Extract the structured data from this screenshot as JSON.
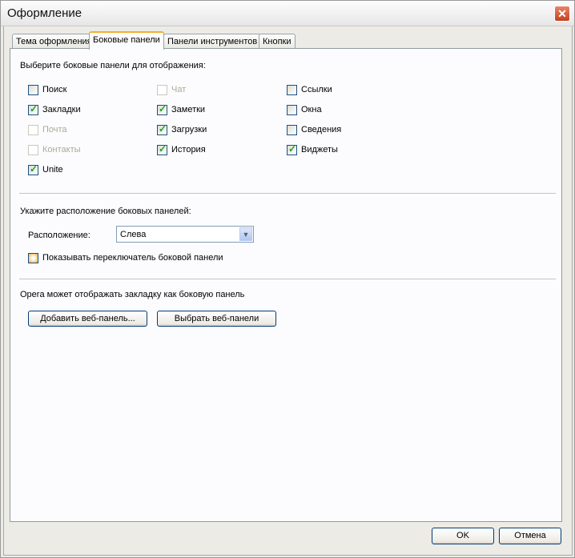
{
  "window": {
    "title": "Оформление",
    "close": "✕"
  },
  "tabs": [
    {
      "label": "Тема оформления"
    },
    {
      "label": "Боковые панели"
    },
    {
      "label": "Панели инструментов"
    },
    {
      "label": "Кнопки"
    }
  ],
  "panels_section": {
    "heading": "Выберите боковые панели для отображения:",
    "items": [
      {
        "label": "Поиск",
        "checked": false,
        "disabled": false
      },
      {
        "label": "Закладки",
        "checked": true,
        "disabled": false
      },
      {
        "label": "Почта",
        "checked": false,
        "disabled": true
      },
      {
        "label": "Контакты",
        "checked": false,
        "disabled": true
      },
      {
        "label": "Unite",
        "checked": true,
        "disabled": false
      },
      {
        "label": "Чат",
        "checked": false,
        "disabled": true
      },
      {
        "label": "Заметки",
        "checked": true,
        "disabled": false
      },
      {
        "label": "Загрузки",
        "checked": true,
        "disabled": false
      },
      {
        "label": "История",
        "checked": true,
        "disabled": false
      },
      {
        "label": "Ссылки",
        "checked": false,
        "disabled": false
      },
      {
        "label": "Окна",
        "checked": false,
        "disabled": false
      },
      {
        "label": "Сведения",
        "checked": false,
        "disabled": false
      },
      {
        "label": "Виджеты",
        "checked": true,
        "disabled": false
      }
    ]
  },
  "position_section": {
    "heading": "Укажите расположение боковых панелей:",
    "position_label": "Расположение:",
    "position_value": "Слева",
    "show_switcher_label": "Показывать переключатель боковой панели"
  },
  "web_section": {
    "text": "Opera может отображать закладку как боковую панель",
    "add_button": "Добавить веб-панель...",
    "choose_button": "Выбрать веб-панели"
  },
  "footer": {
    "ok": "OK",
    "cancel": "Отмена"
  }
}
